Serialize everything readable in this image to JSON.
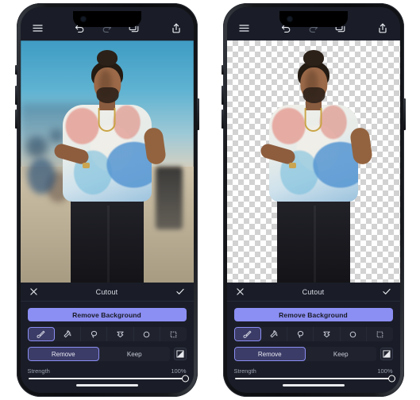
{
  "app": {
    "background_color": "#ffffff",
    "accent_color": "#8b8ef2",
    "panel_color": "#1a1d27"
  },
  "phones": [
    {
      "id": "phone-left",
      "canvas_state": "original-photo-with-background",
      "canvas_label": "Photo of man with hair bun wearing tie-dye t-shirt on a boardwalk"
    },
    {
      "id": "phone-right",
      "canvas_state": "background-removed-transparent-checkerboard",
      "canvas_label": "Same subject cut out on transparent checkerboard background"
    }
  ],
  "topbar": {
    "menu_icon": "hamburger-menu-icon",
    "undo_icon": "undo-icon",
    "redo_icon": "redo-icon",
    "layers_icon": "layers-icon",
    "share_icon": "share-icon"
  },
  "panel": {
    "close_icon": "close-x-icon",
    "title": "Cutout",
    "confirm_icon": "checkmark-icon",
    "primary_button": "Remove Background",
    "tools": [
      {
        "name": "brush-tool",
        "label": "Brush",
        "selected": true
      },
      {
        "name": "magic-wand-tool",
        "label": "Magic Wand",
        "selected": false
      },
      {
        "name": "lasso-tool",
        "label": "Lasso",
        "selected": false
      },
      {
        "name": "polygon-lasso-tool",
        "label": "Polygon Lasso",
        "selected": false
      },
      {
        "name": "ellipse-select-tool",
        "label": "Ellipse",
        "selected": false
      },
      {
        "name": "rectangle-select-tool",
        "label": "Rectangle",
        "selected": false
      }
    ],
    "mode": {
      "remove_label": "Remove",
      "keep_label": "Keep",
      "selected": "Remove",
      "invert_icon": "invert-selection-icon"
    },
    "slider": {
      "label": "Strength",
      "value_label": "100%",
      "value": 100,
      "min": 0,
      "max": 100
    }
  }
}
